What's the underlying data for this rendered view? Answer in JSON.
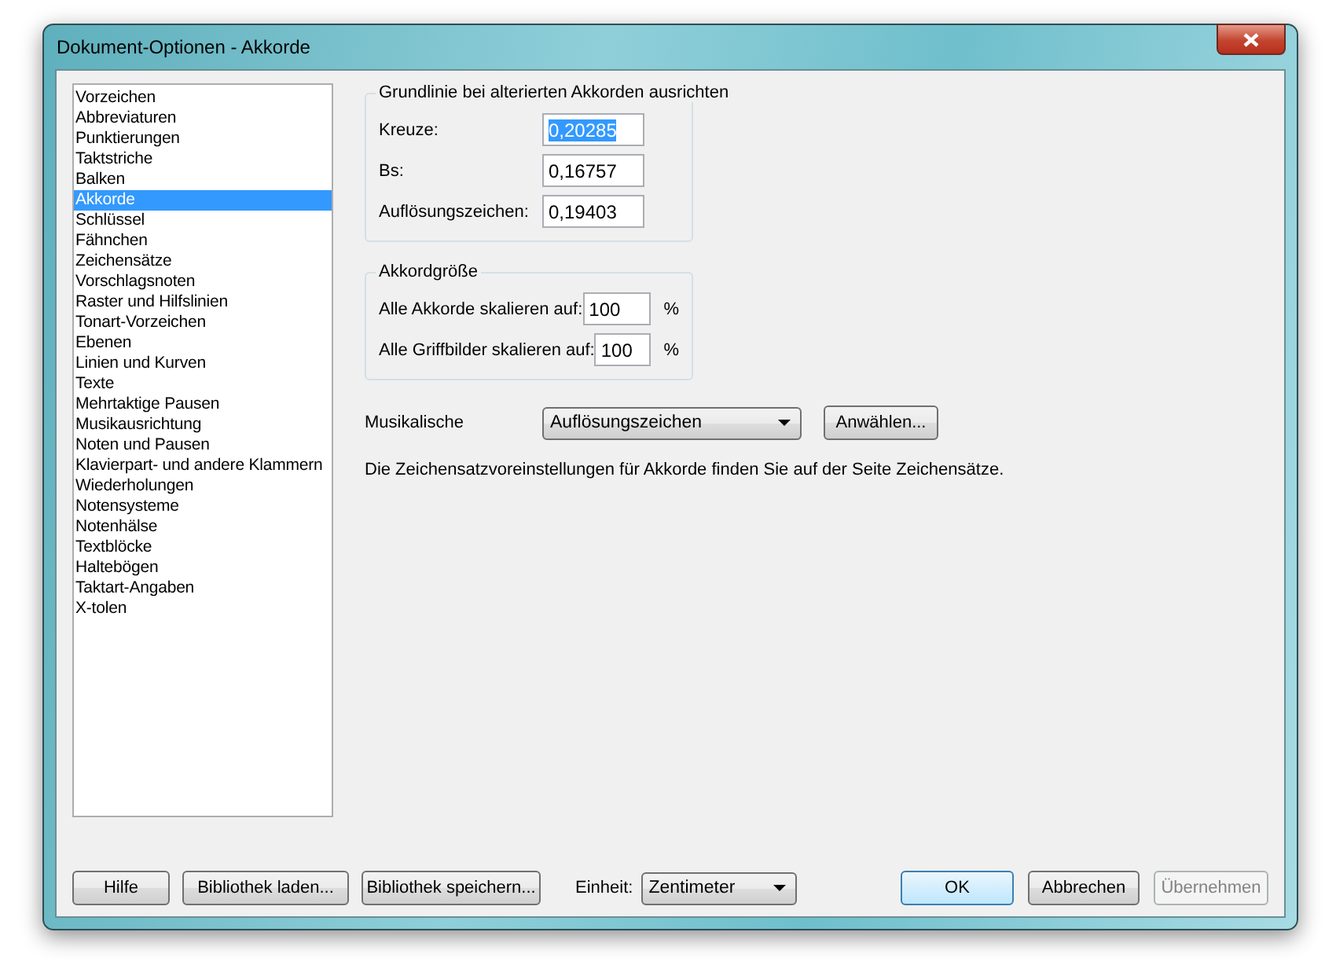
{
  "window": {
    "title": "Dokument-Optionen - Akkorde"
  },
  "sidebar": {
    "items": [
      {
        "label": "Vorzeichen",
        "selected": false
      },
      {
        "label": "Abbreviaturen",
        "selected": false
      },
      {
        "label": "Punktierungen",
        "selected": false
      },
      {
        "label": "Taktstriche",
        "selected": false
      },
      {
        "label": "Balken",
        "selected": false
      },
      {
        "label": "Akkorde",
        "selected": true
      },
      {
        "label": "Schlüssel",
        "selected": false
      },
      {
        "label": "Fähnchen",
        "selected": false
      },
      {
        "label": "Zeichensätze",
        "selected": false
      },
      {
        "label": "Vorschlagsnoten",
        "selected": false
      },
      {
        "label": "Raster und Hilfslinien",
        "selected": false
      },
      {
        "label": "Tonart-Vorzeichen",
        "selected": false
      },
      {
        "label": "Ebenen",
        "selected": false
      },
      {
        "label": "Linien und Kurven",
        "selected": false
      },
      {
        "label": "Texte",
        "selected": false
      },
      {
        "label": "Mehrtaktige Pausen",
        "selected": false
      },
      {
        "label": "Musikausrichtung",
        "selected": false
      },
      {
        "label": "Noten und Pausen",
        "selected": false
      },
      {
        "label": "Klavierpart- und andere Klammern",
        "selected": false
      },
      {
        "label": "Wiederholungen",
        "selected": false
      },
      {
        "label": "Notensysteme",
        "selected": false
      },
      {
        "label": "Notenhälse",
        "selected": false
      },
      {
        "label": "Textblöcke",
        "selected": false
      },
      {
        "label": "Haltebögen",
        "selected": false
      },
      {
        "label": "Taktart-Angaben",
        "selected": false
      },
      {
        "label": "X-tolen",
        "selected": false
      }
    ]
  },
  "baseline_group": {
    "title": "Grundlinie bei alterierten Akkorden ausrichten",
    "fields": [
      {
        "label": "Kreuze:",
        "value": "0,20285",
        "selected": true
      },
      {
        "label": "Bs:",
        "value": "0,16757",
        "selected": false
      },
      {
        "label": "Auflösungszeichen:",
        "value": "0,19403",
        "selected": false
      }
    ]
  },
  "size_group": {
    "title": "Akkordgröße",
    "fields": [
      {
        "label": "Alle Akkorde skalieren auf:",
        "value": "100",
        "unit": "%"
      },
      {
        "label": "Alle Griffbilder skalieren auf:",
        "value": "100",
        "unit": "%"
      }
    ]
  },
  "musical": {
    "label": "Musikalische",
    "dropdown": "Auflösungszeichen",
    "button": "Anwählen..."
  },
  "info_text": "Die Zeichensatzvoreinstellungen für Akkorde finden Sie auf der Seite Zeichensätze.",
  "footer": {
    "left_buttons": [
      "Hilfe",
      "Bibliothek laden...",
      "Bibliothek speichern..."
    ],
    "unit_label": "Einheit:",
    "unit_value": "Zentimeter",
    "right_buttons": [
      {
        "label": "OK",
        "default": true,
        "disabled": false
      },
      {
        "label": "Abbrechen",
        "default": false,
        "disabled": false
      },
      {
        "label": "Übernehmen",
        "default": false,
        "disabled": true
      }
    ]
  }
}
